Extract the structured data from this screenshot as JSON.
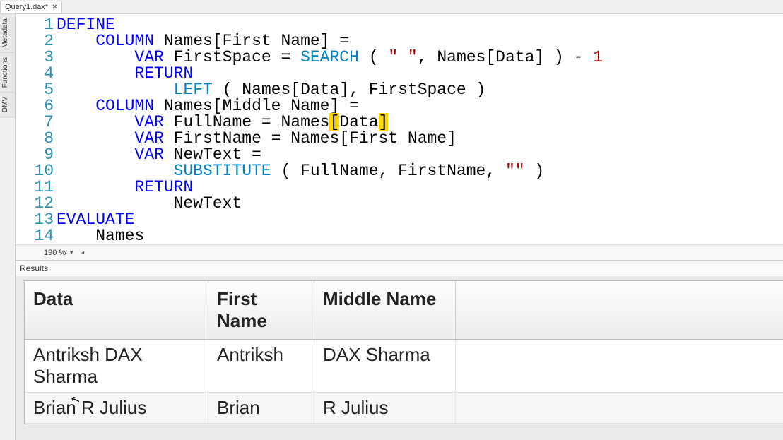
{
  "tab": {
    "title": "Query1.dax*",
    "close": "×"
  },
  "side_tabs": [
    "Metadata",
    "Functions",
    "DMV"
  ],
  "code": {
    "lines": [
      {
        "n": "1",
        "seg": [
          {
            "t": "DEFINE",
            "c": "kw"
          }
        ]
      },
      {
        "n": "2",
        "seg": [
          {
            "t": "    "
          },
          {
            "t": "COLUMN",
            "c": "kw"
          },
          {
            "t": " Names[First Name] ="
          }
        ]
      },
      {
        "n": "3",
        "seg": [
          {
            "t": "        "
          },
          {
            "t": "VAR",
            "c": "kw"
          },
          {
            "t": " FirstSpace = "
          },
          {
            "t": "SEARCH",
            "c": "fn"
          },
          {
            "t": " ( "
          },
          {
            "t": "\" \"",
            "c": "str"
          },
          {
            "t": ", Names[Data] ) - "
          },
          {
            "t": "1",
            "c": "num"
          }
        ]
      },
      {
        "n": "4",
        "seg": [
          {
            "t": "        "
          },
          {
            "t": "RETURN",
            "c": "kw"
          }
        ]
      },
      {
        "n": "5",
        "seg": [
          {
            "t": "            "
          },
          {
            "t": "LEFT",
            "c": "fn"
          },
          {
            "t": " ( Names[Data], FirstSpace )"
          }
        ]
      },
      {
        "n": "6",
        "seg": [
          {
            "t": "    "
          },
          {
            "t": "COLUMN",
            "c": "kw"
          },
          {
            "t": " Names[Middle Name] ="
          }
        ]
      },
      {
        "n": "7",
        "seg": [
          {
            "t": "        "
          },
          {
            "t": "VAR",
            "c": "kw"
          },
          {
            "t": " FullName = Names"
          },
          {
            "t": "[",
            "c": "hl"
          },
          {
            "t": "Data"
          },
          {
            "t": "]",
            "c": "hl"
          }
        ]
      },
      {
        "n": "8",
        "seg": [
          {
            "t": "        "
          },
          {
            "t": "VAR",
            "c": "kw"
          },
          {
            "t": " FirstName = Names[First Name]"
          }
        ]
      },
      {
        "n": "9",
        "seg": [
          {
            "t": "        "
          },
          {
            "t": "VAR",
            "c": "kw"
          },
          {
            "t": " NewText ="
          }
        ]
      },
      {
        "n": "10",
        "seg": [
          {
            "t": "            "
          },
          {
            "t": "SUBSTITUTE",
            "c": "fn"
          },
          {
            "t": " ( FullName, FirstName, "
          },
          {
            "t": "\"\"",
            "c": "str"
          },
          {
            "t": " )"
          }
        ]
      },
      {
        "n": "11",
        "seg": [
          {
            "t": "        "
          },
          {
            "t": "RETURN",
            "c": "kw"
          }
        ]
      },
      {
        "n": "12",
        "seg": [
          {
            "t": "            NewText"
          }
        ]
      },
      {
        "n": "13",
        "seg": [
          {
            "t": "EVALUATE",
            "c": "kw"
          }
        ]
      },
      {
        "n": "14",
        "seg": [
          {
            "t": "    Names"
          }
        ]
      }
    ]
  },
  "zoom": {
    "value": "190 %"
  },
  "results": {
    "label": "Results",
    "columns": [
      "Data",
      "First Name",
      "Middle Name"
    ],
    "rows": [
      [
        "Antriksh DAX Sharma",
        "Antriksh",
        "DAX Sharma"
      ],
      [
        "Brian R Julius",
        "Brian",
        "R Julius"
      ]
    ]
  }
}
